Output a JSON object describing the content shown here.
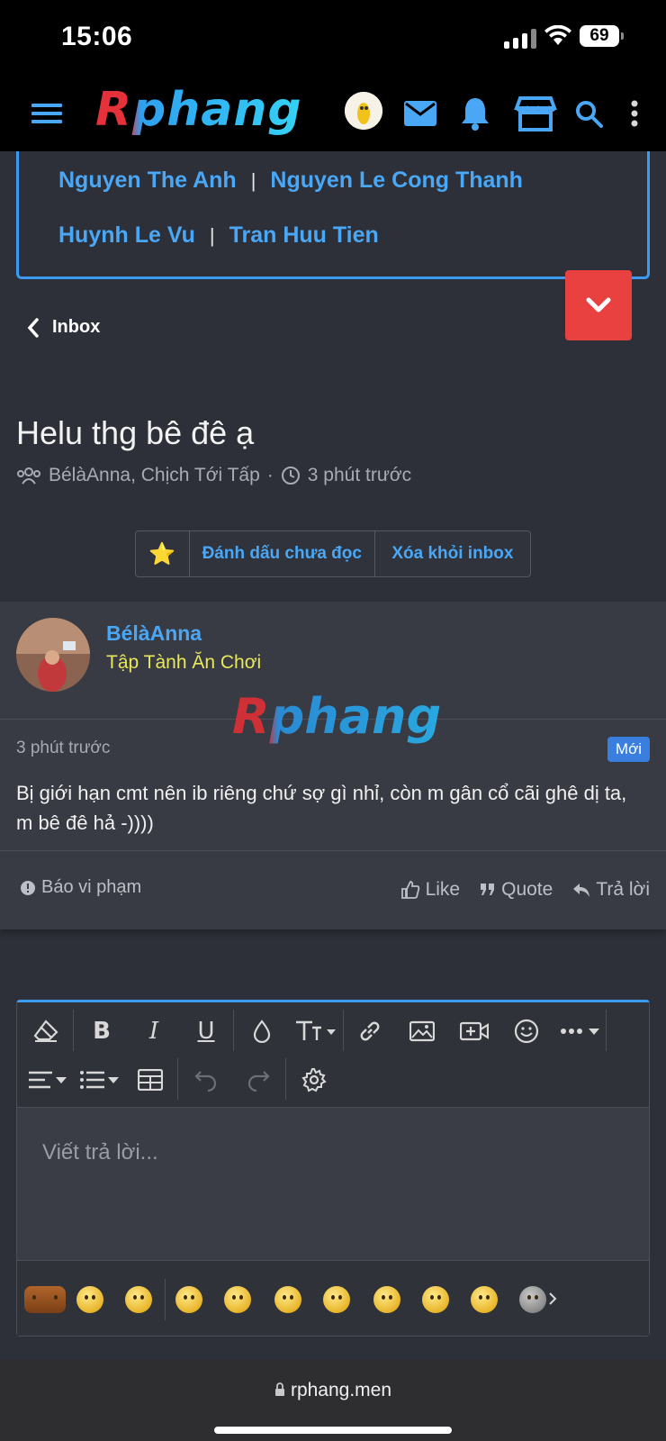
{
  "status": {
    "time": "15:06",
    "battery": "69"
  },
  "header": {
    "logo": "Rphang"
  },
  "moderators": {
    "row1": [
      "Nguyen The Anh",
      "Nguyen Le Cong Thanh"
    ],
    "row2": [
      "Huynh Le Vu",
      "Tran Huu Tien"
    ],
    "separator": "|"
  },
  "nav": {
    "back_label": "Inbox"
  },
  "thread": {
    "title": "Helu thg bê đê ạ",
    "participants": "BélàAnna, Chịch Tới Tấp",
    "dot": "·",
    "time": "3 phút trước"
  },
  "thread_actions": {
    "star": "⭐",
    "mark_unread": "Đánh dấu chưa đọc",
    "remove": "Xóa khỏi inbox"
  },
  "message": {
    "author": "BélàAnna",
    "rank": "Tập Tành Ăn Chơi",
    "watermark": "Rphang",
    "time": "3 phút trước",
    "badge": "Mới",
    "body": "Bị giới hạn cmt nên ib riêng chứ sợ gì nhỉ, còn m gân cổ cãi ghê dị ta, m bê đê hả -))))",
    "report": "Báo vi phạm",
    "like": "Like",
    "quote": "Quote",
    "reply": "Trả lời"
  },
  "editor": {
    "placeholder": "Viết trả lời..."
  },
  "browser": {
    "url": "rphang.men"
  }
}
